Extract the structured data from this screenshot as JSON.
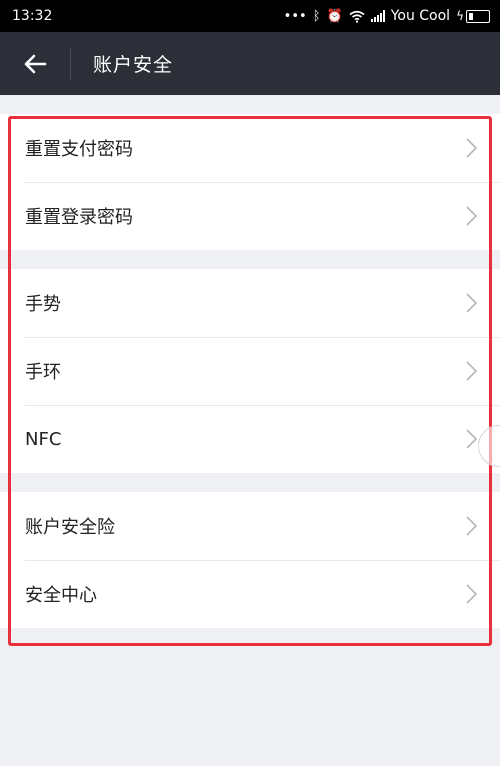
{
  "status_bar": {
    "time": "13:32",
    "carrier": "You Cool"
  },
  "header": {
    "title": "账户安全"
  },
  "groups": [
    {
      "items": [
        {
          "label": "重置支付密码"
        },
        {
          "label": "重置登录密码"
        }
      ]
    },
    {
      "items": [
        {
          "label": "手势"
        },
        {
          "label": "手环"
        },
        {
          "label": "NFC"
        }
      ]
    },
    {
      "items": [
        {
          "label": "账户安全险"
        },
        {
          "label": "安全中心"
        }
      ]
    }
  ],
  "colors": {
    "header_bg": "#2c2f38",
    "highlight": "#e8303d",
    "page_bg": "#eff0f4"
  },
  "icons": [
    "back-arrow-icon",
    "chevron-right-icon",
    "bluetooth-icon",
    "alarm-icon",
    "wifi-icon",
    "signal-icon",
    "battery-icon"
  ]
}
